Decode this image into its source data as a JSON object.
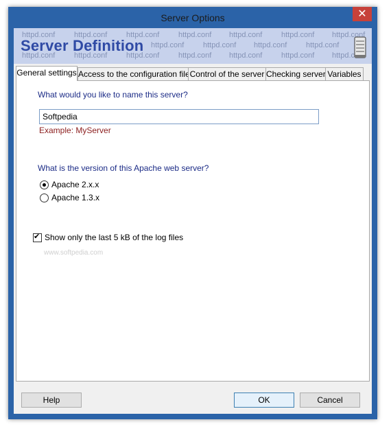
{
  "window": {
    "title": "Server Options",
    "close_glyph": "✕"
  },
  "banner": {
    "title": "Server Definition",
    "watermark_text": "httpd.conf",
    "icon": "server-icon"
  },
  "tabs": [
    {
      "label": "General settings",
      "active": true
    },
    {
      "label": "Access to the configuration file"
    },
    {
      "label": "Control of the server"
    },
    {
      "label": "Checking server"
    },
    {
      "label": "Variables"
    }
  ],
  "general": {
    "name_question": "What would you like to name this server?",
    "name_value": "Softpedia",
    "name_example": "Example: MyServer",
    "version_question": "What is the version of this Apache web server?",
    "versions": [
      {
        "label": "Apache 2.x.x",
        "checked": true
      },
      {
        "label": "Apache 1.3.x",
        "checked": false
      }
    ],
    "log_checkbox_label": "Show only the last 5 kB of the log files",
    "log_checkbox_checked": true,
    "softpedia_watermark": "www.softpedia.com"
  },
  "buttons": {
    "help": "Help",
    "ok": "OK",
    "cancel": "Cancel"
  }
}
